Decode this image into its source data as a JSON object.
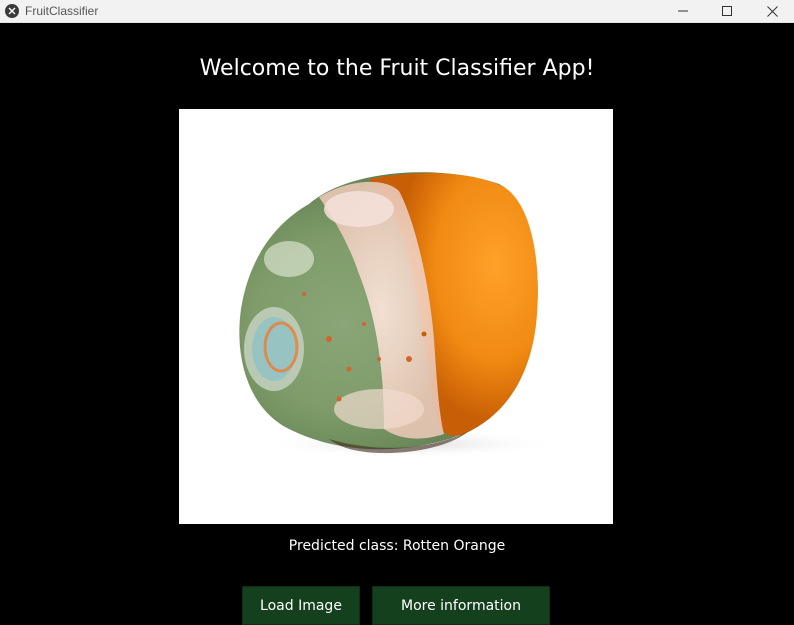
{
  "window": {
    "title": "FruitClassifier",
    "icon": "kivy-app-icon",
    "controls": [
      "minimize-icon",
      "maximize-icon",
      "close-icon"
    ]
  },
  "main": {
    "heading": "Welcome to the Fruit Classifier App!",
    "image_alt": "Rotten orange with mold",
    "prediction_text": "Predicted class: Rotten Orange"
  },
  "buttons": {
    "load_label": "Load Image",
    "info_label": "More information"
  },
  "colors": {
    "background": "#000000",
    "button_bg": "#14401d",
    "image_panel_bg": "#ffffff",
    "text": "#ffffff"
  }
}
